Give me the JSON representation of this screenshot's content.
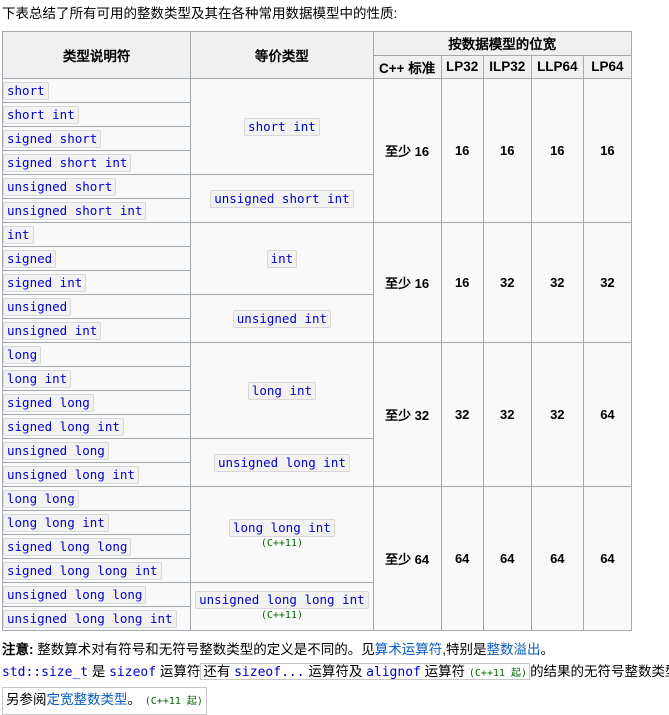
{
  "intro": "下表总结了所有可用的整数类型及其在各种常用数据模型中的性质:",
  "table": {
    "headers": {
      "specifier": "类型说明符",
      "equivalent": "等价类型",
      "group": "按数据模型的位宽",
      "models": [
        "C++ 标准",
        "LP32",
        "ILP32",
        "LLP64",
        "LP64"
      ]
    },
    "groups": [
      {
        "equivalents": [
          {
            "code": "short int",
            "since": "",
            "rowspan": 4
          },
          {
            "code": "unsigned short int",
            "since": "",
            "rowspan": 2
          }
        ],
        "specifiers": [
          "short",
          "short int",
          "signed short",
          "signed short int",
          "unsigned short",
          "unsigned short int"
        ],
        "widths": [
          "至少 16",
          "16",
          "16",
          "16",
          "16"
        ]
      },
      {
        "equivalents": [
          {
            "code": "int",
            "since": "",
            "rowspan": 3
          },
          {
            "code": "unsigned int",
            "since": "",
            "rowspan": 2
          }
        ],
        "specifiers": [
          "int",
          "signed",
          "signed int",
          "unsigned",
          "unsigned int"
        ],
        "widths": [
          "至少 16",
          "16",
          "32",
          "32",
          "32"
        ]
      },
      {
        "equivalents": [
          {
            "code": "long int",
            "since": "",
            "rowspan": 4
          },
          {
            "code": "unsigned long int",
            "since": "",
            "rowspan": 2
          }
        ],
        "specifiers": [
          "long",
          "long int",
          "signed long",
          "signed long int",
          "unsigned long",
          "unsigned long int"
        ],
        "widths": [
          "至少 32",
          "32",
          "32",
          "32",
          "64"
        ]
      },
      {
        "equivalents": [
          {
            "code": "long long int",
            "since": "(C++11)",
            "rowspan": 4
          },
          {
            "code": "unsigned long long int",
            "since": "(C++11)",
            "rowspan": 2
          }
        ],
        "specifiers": [
          "long long",
          "long long int",
          "signed long long",
          "signed long long int",
          "unsigned long long",
          "unsigned long long int"
        ],
        "widths": [
          "至少 64",
          "64",
          "64",
          "64",
          "64"
        ]
      }
    ]
  },
  "notes": {
    "line1": {
      "label": "注意:",
      "text_a": " 整数算术对有符号和无符号整数类型的定义是不同的。见",
      "link_a": "算术运算符",
      "text_b": ",特别是",
      "link_b": "整数溢出",
      "text_c": "。"
    },
    "line2": {
      "code_a": "std::size_t",
      "text_a": " 是 ",
      "code_b": "sizeof",
      "text_b": " 运算符",
      "boxed_text_a": "还有 ",
      "boxed_code_a": "sizeof...",
      "boxed_text_b": " 运算符及 ",
      "boxed_code_b": "alignof",
      "boxed_text_c": " 运算符 ",
      "boxed_since": "(C++11 起)",
      "text_c": "的结果的无符号整数类型。"
    },
    "line3": {
      "text_a": "另参阅",
      "link": "定宽整数类型",
      "text_b": "。",
      "since": "(C++11 起)"
    }
  },
  "colors": {
    "code_text": "#0000cd",
    "link": "#0b5cbf",
    "since_green": "#006400",
    "border": "#a2a9b1",
    "header_bg": "#f0f0f0",
    "cell_bg": "#f9f9f9"
  }
}
